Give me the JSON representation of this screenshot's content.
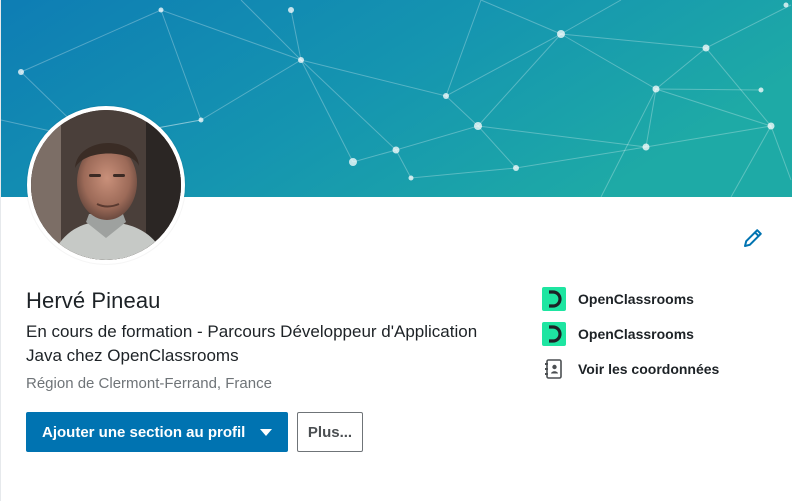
{
  "profile": {
    "name": "Hervé Pineau",
    "headline": "En cours de formation - Parcours Développeur d'Application Java chez OpenClassrooms",
    "location": "Région de Clermont-Ferrand, France"
  },
  "actions": {
    "add_section_label": "Ajouter une section au profil",
    "more_label": "Plus..."
  },
  "side": {
    "items": [
      {
        "label": "OpenClassrooms",
        "icon": "openclassrooms-logo"
      },
      {
        "label": "OpenClassrooms",
        "icon": "openclassrooms-logo"
      },
      {
        "label": "Voir les coordonnées",
        "icon": "contact-card-icon"
      }
    ]
  },
  "colors": {
    "primary": "#0073b1",
    "banner_start": "#0f7fb5",
    "banner_end": "#1aa3a6",
    "oc_green": "#1ee5a1"
  }
}
